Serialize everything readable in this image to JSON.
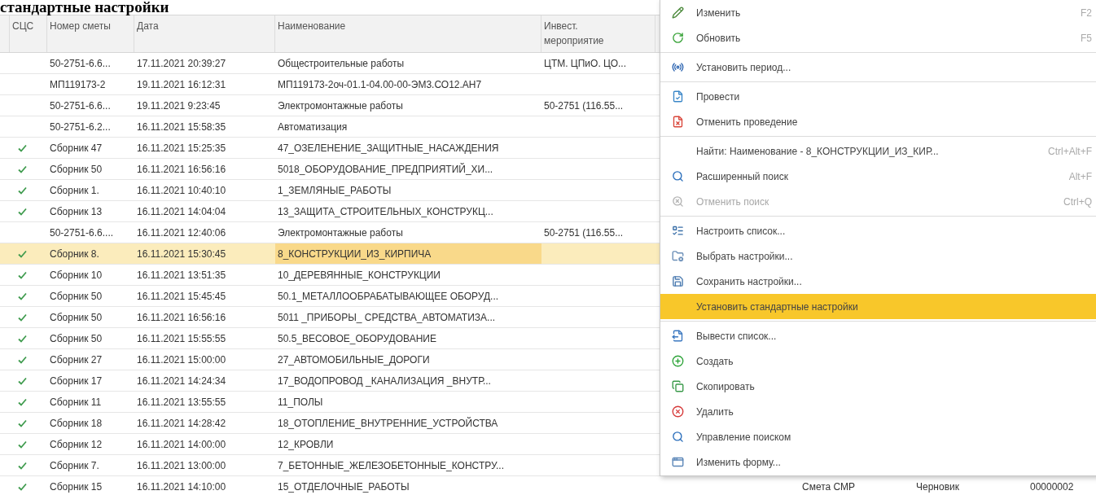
{
  "heading": "стандартные настройки",
  "table": {
    "columns": [
      "СЦС",
      "Номер сметы",
      "Дата",
      "Наименование",
      "Инвест. мероприятие"
    ],
    "rows": [
      {
        "checked": false,
        "selected": false,
        "number": "50-2751-6.6...",
        "date": "17.11.2021 20:39:27",
        "name": "Общестроительные работы",
        "invest": "ЦТМ. ЦПиО. ЦО..."
      },
      {
        "checked": false,
        "selected": false,
        "number": "МП119173-2",
        "date": "19.11.2021 16:12:31",
        "name": "МП119173-2оч-01.1-04.00-00-ЭМ3.СО12.АН7"
      },
      {
        "checked": false,
        "selected": false,
        "number": "50-2751-6.6...",
        "date": "19.11.2021 9:23:45",
        "name": "Электромонтажные работы",
        "invest": "50-2751 (116.55..."
      },
      {
        "checked": false,
        "selected": false,
        "number": "50-2751-6.2...",
        "date": "16.11.2021 15:58:35",
        "name": "Автоматизация"
      },
      {
        "checked": true,
        "selected": false,
        "number": "Сборник 47",
        "date": "16.11.2021 15:25:35",
        "name": "47_ОЗЕЛЕНЕНИЕ_ЗАЩИТНЫЕ_НАСАЖДЕНИЯ"
      },
      {
        "checked": true,
        "selected": false,
        "number": "Сборник 50",
        "date": "16.11.2021 16:56:16",
        "name": "5018_ОБОРУДОВАНИЕ_ПРЕДПРИЯТИЙ_ХИ..."
      },
      {
        "checked": true,
        "selected": false,
        "number": "Сборник 1.",
        "date": "16.11.2021 10:40:10",
        "name": "1_ЗЕМЛЯНЫЕ_РАБОТЫ"
      },
      {
        "checked": true,
        "selected": false,
        "number": "Сборник 13",
        "date": "16.11.2021 14:04:04",
        "name": "13_ЗАЩИТА_СТРОИТЕЛЬНЫХ_КОНСТРУКЦ..."
      },
      {
        "checked": false,
        "selected": false,
        "number": "50-2751-6.6....",
        "date": "16.11.2021 12:40:06",
        "name": "Электромонтажные работы",
        "invest": "50-2751 (116.55..."
      },
      {
        "checked": true,
        "selected": true,
        "number": "Сборник 8.",
        "date": "16.11.2021 15:30:45",
        "name": "8_КОНСТРУКЦИИ_ИЗ_КИРПИЧА"
      },
      {
        "checked": true,
        "selected": false,
        "number": "Сборник 10",
        "date": "16.11.2021 13:51:35",
        "name": "10_ДЕРЕВЯННЫЕ_КОНСТРУКЦИИ"
      },
      {
        "checked": true,
        "selected": false,
        "number": "Сборник 50",
        "date": "16.11.2021 15:45:45",
        "name": "50.1_МЕТАЛЛООБРАБАТЫВАЮЩЕЕ ОБОРУД..."
      },
      {
        "checked": true,
        "selected": false,
        "number": "Сборник 50",
        "date": "16.11.2021 16:56:16",
        "name": "5011 _ПРИБОРЫ_ СРЕДСТВА_АВТОМАТИЗА..."
      },
      {
        "checked": true,
        "selected": false,
        "number": "Сборник 50",
        "date": "16.11.2021 15:55:55",
        "name": "50.5_ВЕСОВОЕ_ОБОРУДОВАНИЕ"
      },
      {
        "checked": true,
        "selected": false,
        "number": "Сборник 27",
        "date": "16.11.2021 15:00:00",
        "name": "27_АВТОМОБИЛЬНЫЕ_ДОРОГИ"
      },
      {
        "checked": true,
        "selected": false,
        "number": "Сборник 17",
        "date": "16.11.2021 14:24:34",
        "name": "17_ВОДОПРОВОД _КАНАЛИЗАЦИЯ _ВНУТР..."
      },
      {
        "checked": true,
        "selected": false,
        "number": "Сборник 11",
        "date": "16.11.2021 13:55:55",
        "name": "11_ПОЛЫ"
      },
      {
        "checked": true,
        "selected": false,
        "number": "Сборник 18",
        "date": "16.11.2021 14:28:42",
        "name": "18_ОТОПЛЕНИЕ_ВНУТРЕННИЕ_УСТРОЙСТВА"
      },
      {
        "checked": true,
        "selected": false,
        "number": "Сборник 12",
        "date": "16.11.2021 14:00:00",
        "name": "12_КРОВЛИ"
      },
      {
        "checked": true,
        "selected": false,
        "number": "Сборник 7.",
        "date": "16.11.2021 13:00:00",
        "name": "7_БЕТОННЫЕ_ЖЕЛЕЗОБЕТОННЫЕ_КОНСТРУ..."
      },
      {
        "checked": true,
        "selected": false,
        "number": "Сборник 15",
        "date": "16.11.2021 14:10:00",
        "name": "15_ОТДЕЛОЧНЫЕ_РАБОТЫ",
        "column_7": "Смета СМР",
        "column_8": "Черновик",
        "column_9": "00000002"
      }
    ]
  },
  "context_menu": [
    {
      "kind": "item",
      "label": "Изменить",
      "shortcut": "F2",
      "disabled": false,
      "selected": false
    },
    {
      "kind": "item",
      "label": "Обновить",
      "shortcut": "F5",
      "disabled": false,
      "selected": false
    },
    {
      "kind": "separator"
    },
    {
      "kind": "item",
      "label": "Установить период...",
      "disabled": false,
      "selected": false
    },
    {
      "kind": "separator"
    },
    {
      "kind": "item",
      "label": "Провести",
      "disabled": false,
      "selected": false
    },
    {
      "kind": "item",
      "label": "Отменить проведение",
      "disabled": false,
      "selected": false
    },
    {
      "kind": "separator"
    },
    {
      "kind": "item",
      "label": "Найти: Наименование - 8_КОНСТРУКЦИИ_ИЗ_КИР...",
      "shortcut": "Ctrl+Alt+F",
      "disabled": false,
      "selected": false
    },
    {
      "kind": "item",
      "label": "Расширенный поиск",
      "shortcut": "Alt+F",
      "disabled": false,
      "selected": false
    },
    {
      "kind": "item",
      "label": "Отменить поиск",
      "shortcut": "Ctrl+Q",
      "disabled": true,
      "selected": false
    },
    {
      "kind": "separator"
    },
    {
      "kind": "item",
      "label": "Настроить список...",
      "disabled": false,
      "selected": false
    },
    {
      "kind": "item",
      "label": "Выбрать настройки...",
      "disabled": false,
      "selected": false
    },
    {
      "kind": "item",
      "label": "Сохранить настройки...",
      "disabled": false,
      "selected": false
    },
    {
      "kind": "item",
      "label": "Установить стандартные настройки",
      "disabled": false,
      "selected": true
    },
    {
      "kind": "separator"
    },
    {
      "kind": "item",
      "label": "Вывести список...",
      "disabled": false,
      "selected": false
    },
    {
      "kind": "item",
      "label": "Создать",
      "disabled": false,
      "selected": false
    },
    {
      "kind": "item",
      "label": "Скопировать",
      "disabled": false,
      "selected": false
    },
    {
      "kind": "item",
      "label": "Удалить",
      "disabled": false,
      "selected": false
    },
    {
      "kind": "item",
      "label": "Управление поиском",
      "disabled": false,
      "selected": false
    },
    {
      "kind": "item",
      "label": "Изменить форму...",
      "disabled": false,
      "selected": false
    }
  ]
}
